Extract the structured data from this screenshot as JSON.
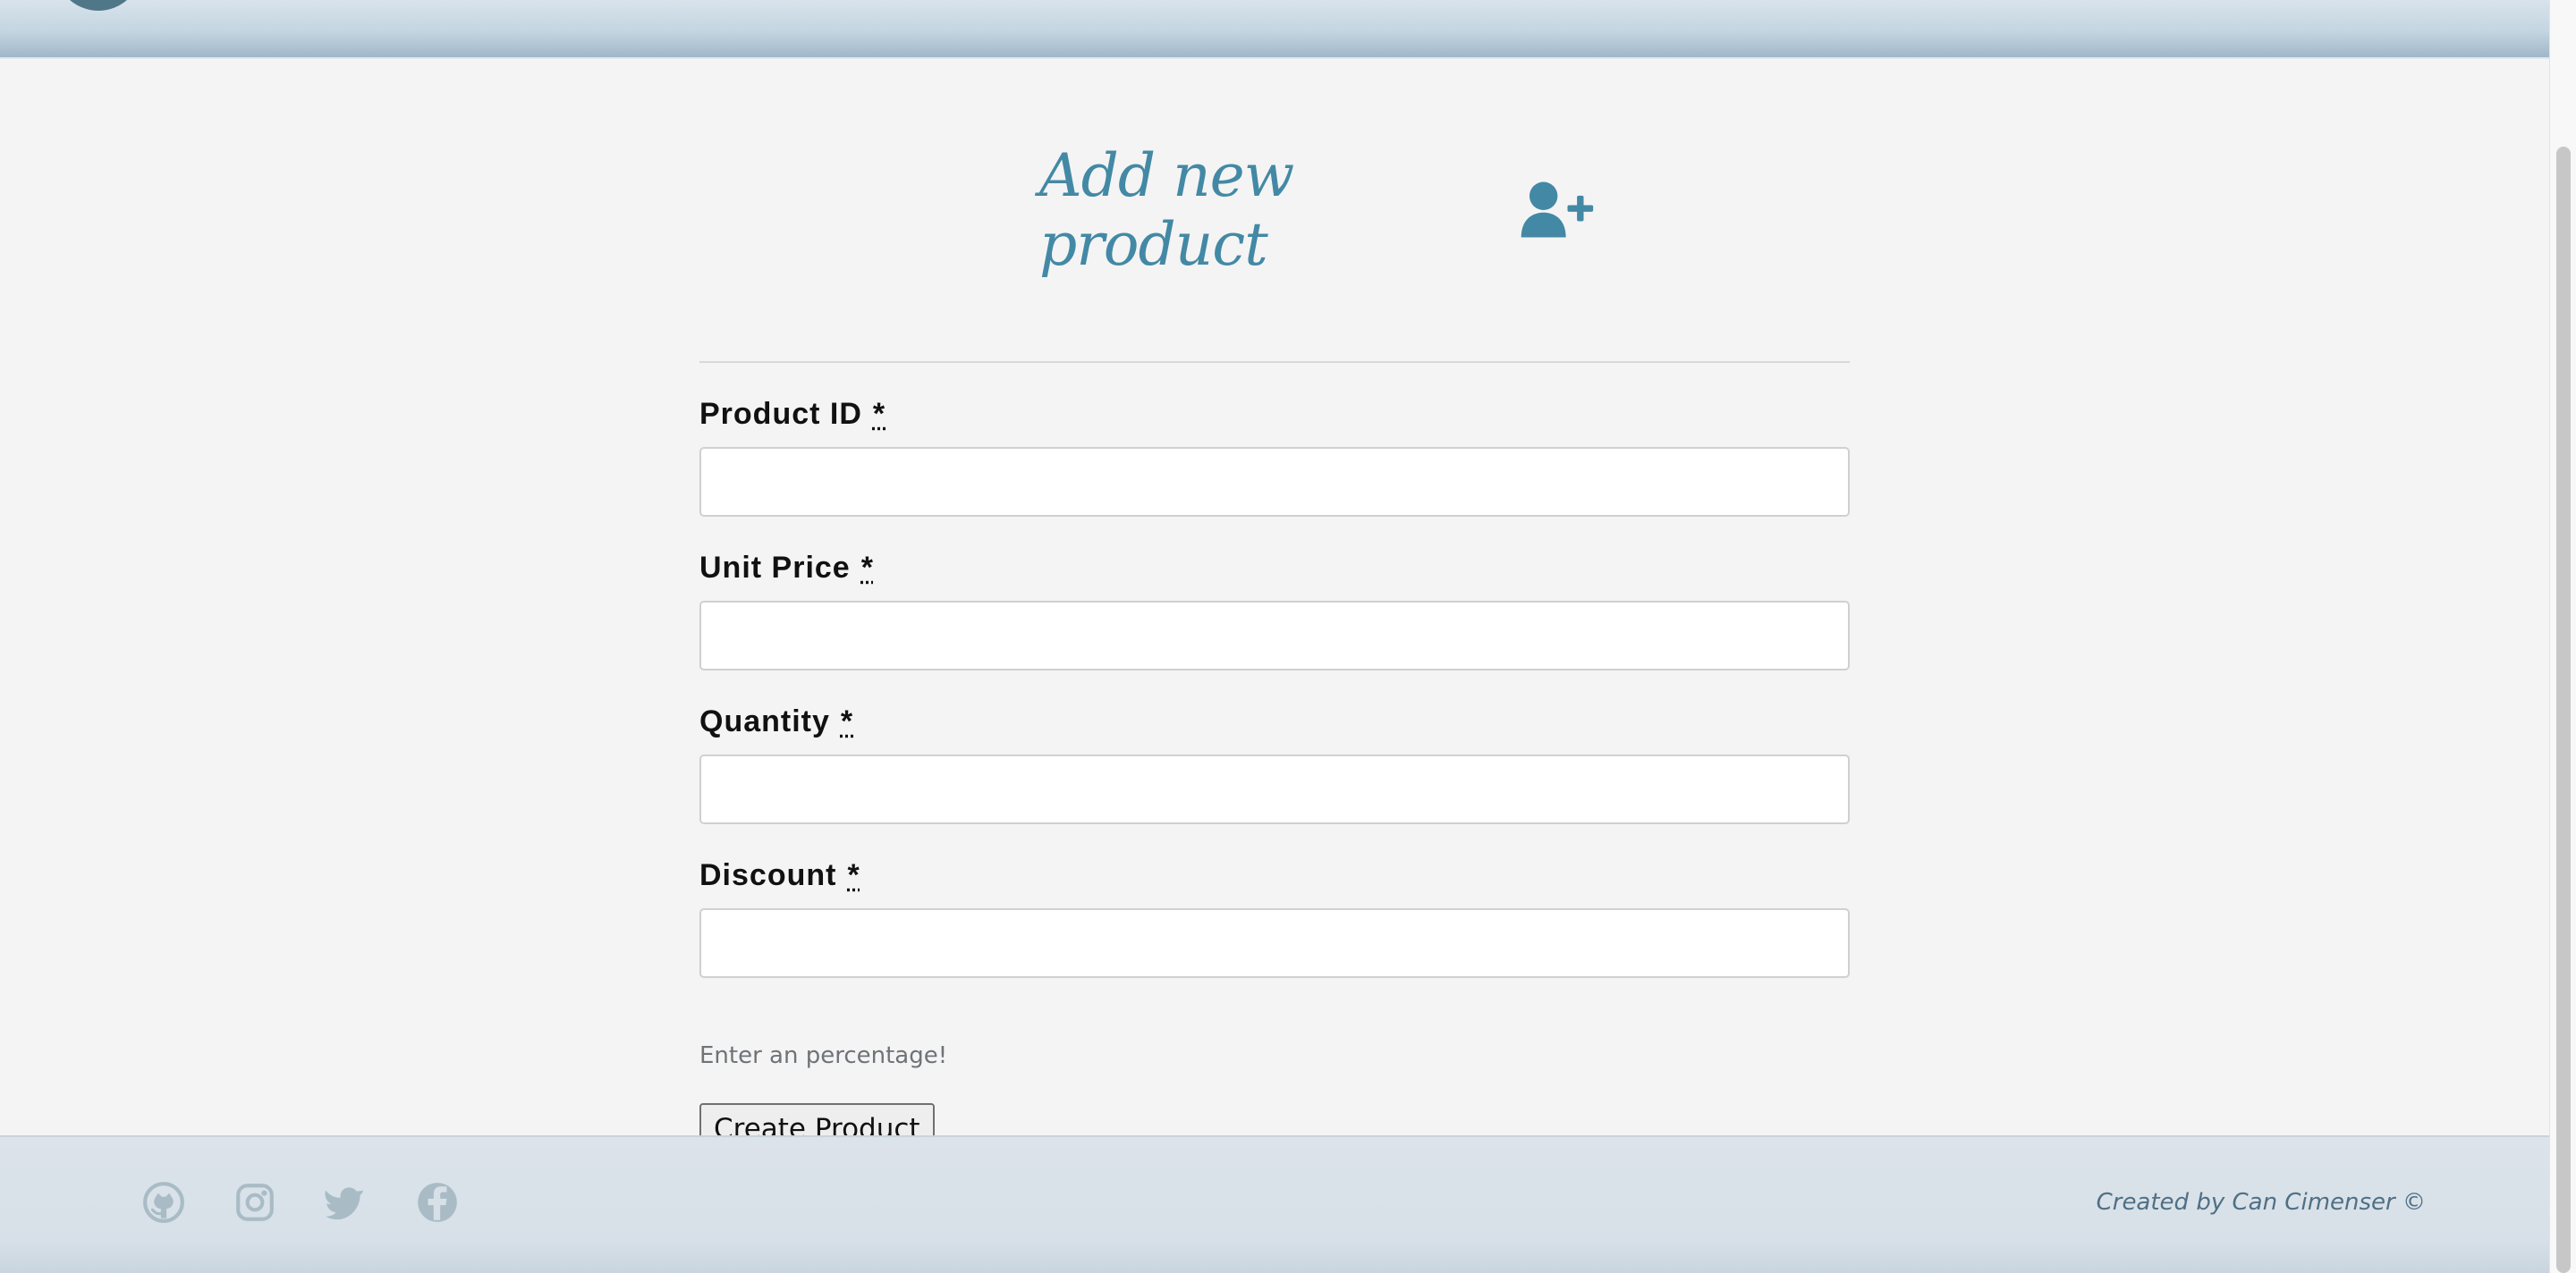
{
  "page": {
    "title": "Add new product",
    "accent_color": "#4389a5"
  },
  "header": {
    "logo_icon": "brand-logo"
  },
  "form": {
    "title_icon": "user-plus-icon",
    "fields": [
      {
        "label": "Product ID",
        "required_mark": "*",
        "value": "",
        "placeholder": ""
      },
      {
        "label": "Unit Price",
        "required_mark": "*",
        "value": "",
        "placeholder": ""
      },
      {
        "label": "Quantity",
        "required_mark": "*",
        "value": "",
        "placeholder": ""
      },
      {
        "label": "Discount",
        "required_mark": "*",
        "value": "",
        "placeholder": ""
      }
    ],
    "discount_help": "Enter an percentage!",
    "submit_label": "Create Product"
  },
  "footer": {
    "social_icons": [
      "github-icon",
      "instagram-icon",
      "twitter-icon",
      "facebook-icon"
    ],
    "credit": "Created by Can Cimenser ©"
  }
}
